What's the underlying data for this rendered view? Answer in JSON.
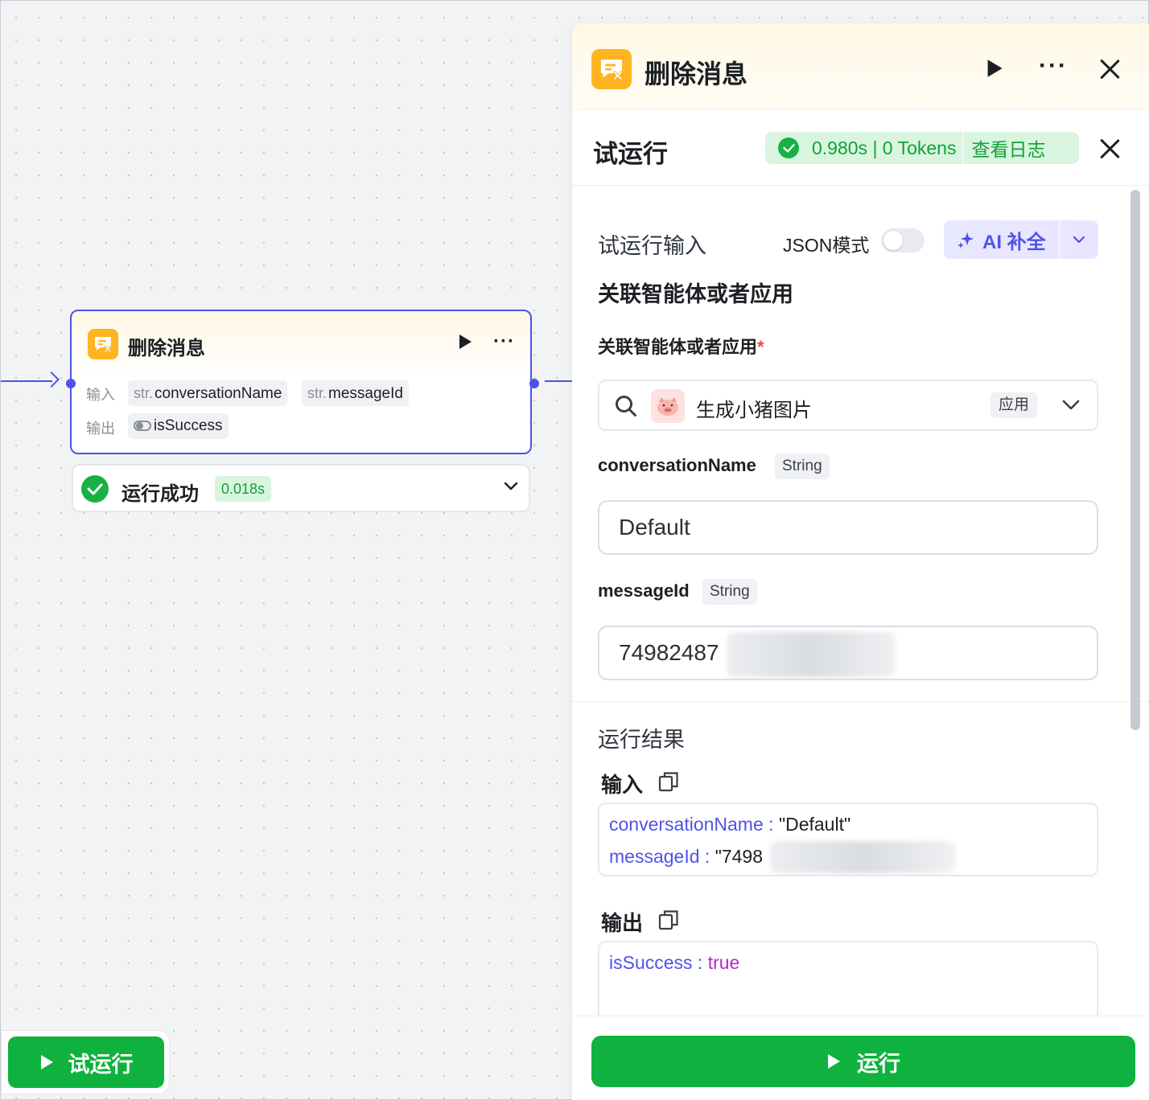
{
  "node": {
    "title": "删除消息",
    "input_label": "输入",
    "output_label": "输出",
    "inputs": [
      {
        "prefix": "str.",
        "name": "conversationName"
      },
      {
        "prefix": "str.",
        "name": "messageId"
      }
    ],
    "outputs": [
      {
        "name": "isSuccess"
      }
    ],
    "status": {
      "text": "运行成功",
      "time": "0.018s"
    }
  },
  "canvas": {
    "test_run_label": "试运行"
  },
  "panel": {
    "title": "删除消息",
    "trial": {
      "title": "试运行",
      "stats": "0.980s | 0 Tokens",
      "log_link": "查看日志",
      "input_section": "试运行输入",
      "json_mode_label": "JSON模式",
      "ai_fill_label": "AI 补全",
      "group_title": "关联智能体或者应用",
      "app_field": {
        "label": "关联智能体或者应用",
        "required_mark": "*",
        "selected": "生成小猪图片",
        "tag": "应用"
      },
      "fields": [
        {
          "name": "conversationName",
          "type": "String",
          "value": "Default"
        },
        {
          "name": "messageId",
          "type": "String",
          "value": "74982487"
        }
      ]
    },
    "result": {
      "title": "运行结果",
      "input_label": "输入",
      "output_label": "输出",
      "input_lines": [
        {
          "key": "conversationName",
          "sep": " : ",
          "value": "\"Default\""
        },
        {
          "key": "messageId",
          "sep": " : ",
          "value": "\"7498"
        }
      ],
      "output_lines": [
        {
          "key": "isSuccess",
          "sep": " : ",
          "value": "true"
        }
      ]
    },
    "run_button_label": "运行"
  },
  "colors": {
    "accent": "#4d53e8",
    "success": "#0fb23f",
    "node_icon": "#ffb422",
    "bool_value": "#b22bc9"
  },
  "icons": [
    "message-delete-icon",
    "play-icon",
    "more-icon",
    "close-icon",
    "check-circle-icon",
    "chevron-down-icon",
    "search-icon",
    "sparkle-icon",
    "copy-icon",
    "pig-avatar-icon"
  ]
}
